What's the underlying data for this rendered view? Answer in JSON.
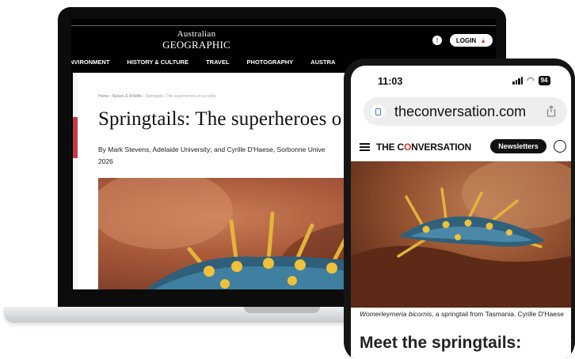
{
  "laptop": {
    "site": {
      "logo_line1": "Australian",
      "logo_line2": "GEOGRAPHIC",
      "login_label": "LOGIN",
      "nav": [
        "NVIRONMENT",
        "HISTORY & CULTURE",
        "TRAVEL",
        "PHOTOGRAPHY",
        "AUSTRA"
      ],
      "breadcrumb": [
        "Home",
        "Nature & Wildlife",
        "Springtails: The superheroes of our soils"
      ],
      "title": "Springtails: The superheroes o",
      "byline": "By Mark Stevens, Adelaide University; and Cyrille D'Haese, Sorbonne Unive",
      "byline_line2": "2026"
    }
  },
  "phone": {
    "status": {
      "time": "11:03",
      "battery": "94"
    },
    "url": "theconversation.com",
    "site": {
      "logo_pre": "THE C",
      "logo_o": "O",
      "logo_post": "NVERSATION",
      "newsletters_label": "Newsletters",
      "caption_italic": "Womerleymeria bicornis",
      "caption_rest": ", a springtail from Tasmania. Cyrille D'Haese",
      "headline": "Meet the springtails:"
    }
  },
  "colors": {
    "accent_red": "#e23b2f",
    "conversation_red": "#d8352a",
    "link_blue": "#3478f6"
  }
}
